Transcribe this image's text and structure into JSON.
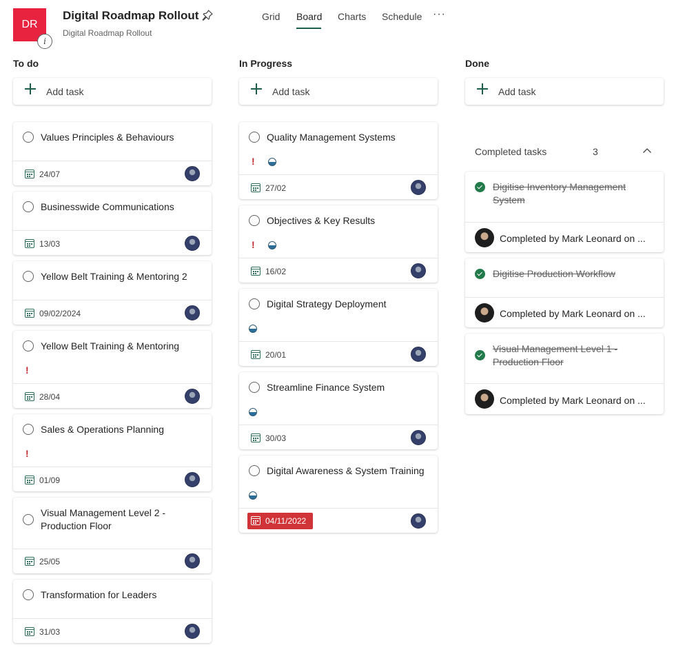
{
  "header": {
    "avatar_initials": "DR",
    "info_icon": "i",
    "title": "Digital Roadmap Rollout",
    "subtitle": "Digital Roadmap Rollout",
    "tabs": [
      "Grid",
      "Board",
      "Charts",
      "Schedule"
    ],
    "active_tab": "Board",
    "more": "···"
  },
  "colors": {
    "accent": "#1b5e4a",
    "avatar": "#e8233f",
    "overdue": "#d13438",
    "urgent": "#c4262e",
    "complete": "#237b4b"
  },
  "add_task_label": "Add task",
  "columns": {
    "todo": {
      "title": "To do",
      "cards": [
        {
          "title": "Values Principles & Behaviours",
          "date": "24/07"
        },
        {
          "title": "Businesswide Communications",
          "date": "13/03"
        },
        {
          "title": "Yellow Belt Training & Mentoring 2",
          "date": "09/02/2024"
        },
        {
          "title": "Yellow Belt Training & Mentoring",
          "urgent": "!",
          "date": "28/04"
        },
        {
          "title": "Sales & Operations Planning",
          "urgent": "!",
          "date": "01/09"
        },
        {
          "title": "Visual Management Level 2 - Production Floor",
          "date": "25/05"
        },
        {
          "title": "Transformation for Leaders",
          "date": "31/03"
        }
      ]
    },
    "progress": {
      "title": "In Progress",
      "cards": [
        {
          "title": "Quality Management Systems",
          "urgent": "!",
          "date": "27/02"
        },
        {
          "title": "Objectives & Key Results",
          "urgent": "!",
          "date": "16/02"
        },
        {
          "title": "Digital Strategy Deployment",
          "date": "20/01"
        },
        {
          "title": "Streamline Finance System",
          "date": "30/03"
        },
        {
          "title": "Digital Awareness & System Training",
          "date": "04/11/2022",
          "overdue": true
        }
      ]
    },
    "done": {
      "title": "Done",
      "completed_label": "Completed tasks",
      "completed_count": "3",
      "cards": [
        {
          "title": "Digitise Inventory Management System",
          "completed_by": "Completed by Mark Leonard on ..."
        },
        {
          "title": "Digitise Production Workflow",
          "completed_by": "Completed by Mark Leonard on ..."
        },
        {
          "title": "Visual Management Level 1 - Production Floor",
          "completed_by": "Completed by Mark Leonard on ..."
        }
      ]
    }
  }
}
